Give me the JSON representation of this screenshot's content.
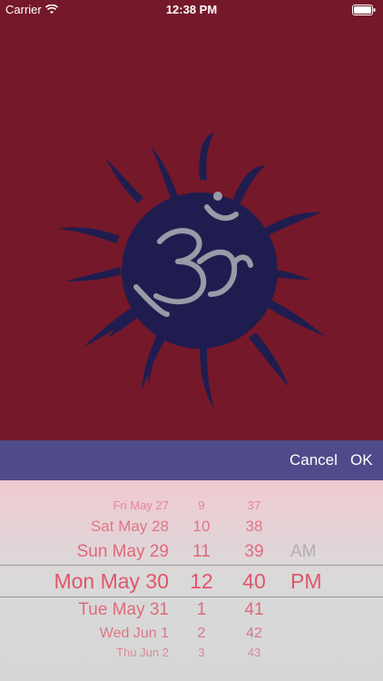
{
  "status_bar": {
    "carrier": "Carrier",
    "time": "12:38 PM",
    "wifi_icon": "wifi-icon",
    "battery_icon": "battery-icon"
  },
  "hero": {
    "logo": "om-sun-logo",
    "colors": {
      "background": "#75182a",
      "sun": "#1f1d4f",
      "symbol": "#9a9aa8"
    }
  },
  "toolbar": {
    "cancel_label": "Cancel",
    "ok_label": "OK",
    "background": "#4f4b8b"
  },
  "picker": {
    "dates": [
      "Fri May 27",
      "Sat May 28",
      "Sun May 29",
      "Mon May 30",
      "Tue May 31",
      "Wed Jun 1",
      "Thu Jun 2"
    ],
    "hours": [
      "9",
      "10",
      "11",
      "12",
      "1",
      "2",
      "3"
    ],
    "minutes": [
      "37",
      "38",
      "39",
      "40",
      "41",
      "42",
      "43"
    ],
    "ampm": [
      "AM",
      "PM"
    ],
    "selected": {
      "date": "Mon May 30",
      "hour": "12",
      "minute": "40",
      "ampm": "PM"
    },
    "text_color": "#e0566a"
  }
}
